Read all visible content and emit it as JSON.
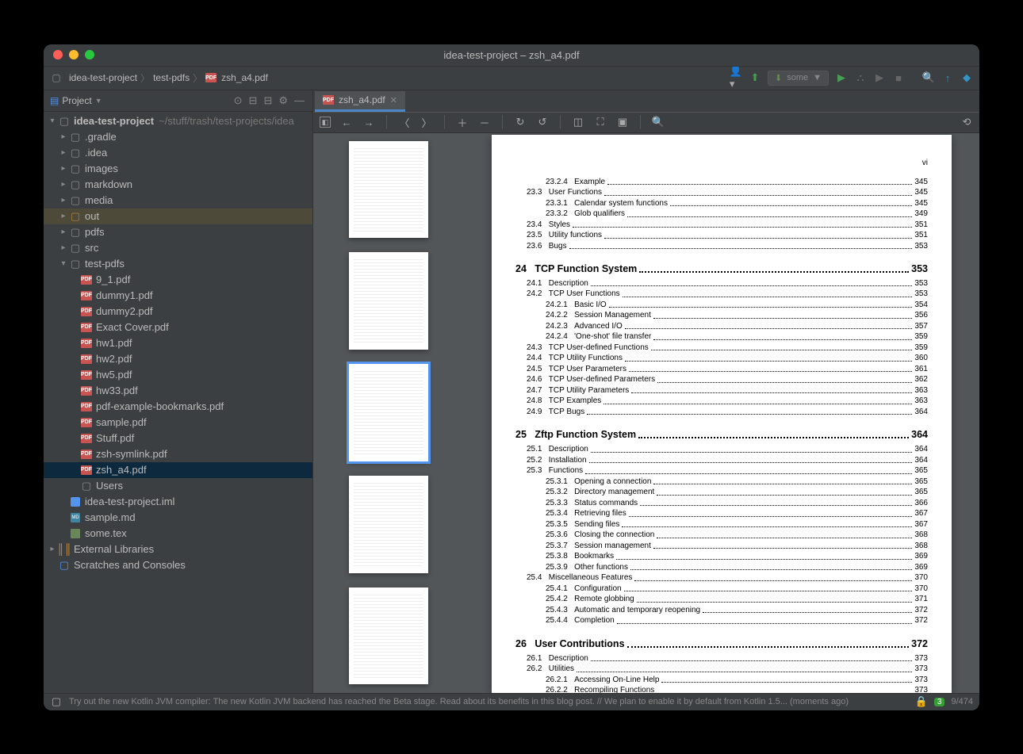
{
  "window_title": "idea-test-project – zsh_a4.pdf",
  "breadcrumbs": [
    "idea-test-project",
    "test-pdfs",
    "zsh_a4.pdf"
  ],
  "run_config": "some",
  "sidebar": {
    "title": "Project",
    "project_name": "idea-test-project",
    "project_path": "~/stuff/trash/test-projects/idea",
    "folders": [
      ".gradle",
      ".idea",
      "images",
      "markdown",
      "media",
      "out",
      "pdfs",
      "src"
    ],
    "testpdfs_label": "test-pdfs",
    "pdfs": [
      "9_1.pdf",
      "dummy1.pdf",
      "dummy2.pdf",
      "Exact Cover.pdf",
      "hw1.pdf",
      "hw2.pdf",
      "hw5.pdf",
      "hw33.pdf",
      "pdf-example-bookmarks.pdf",
      "sample.pdf",
      "Stuff.pdf",
      "zsh-symlink.pdf",
      "zsh_a4.pdf"
    ],
    "users": "Users",
    "iml": "idea-test-project.iml",
    "samplemd": "sample.md",
    "sometex": "some.tex",
    "ext": "External Libraries",
    "scratch": "Scratches and Consoles"
  },
  "tab_label": "zsh_a4.pdf",
  "page_num_corner": "vi",
  "toc_pre": [
    {
      "n": "23.2.4",
      "t": "Example",
      "p": "345",
      "i": 2
    },
    {
      "n": "23.3",
      "t": "User Functions",
      "p": "345",
      "i": 1
    },
    {
      "n": "23.3.1",
      "t": "Calendar system functions",
      "p": "345",
      "i": 2
    },
    {
      "n": "23.3.2",
      "t": "Glob qualifiers",
      "p": "349",
      "i": 2
    },
    {
      "n": "23.4",
      "t": "Styles",
      "p": "351",
      "i": 1
    },
    {
      "n": "23.5",
      "t": "Utility functions",
      "p": "351",
      "i": 1
    },
    {
      "n": "23.6",
      "t": "Bugs",
      "p": "353",
      "i": 1
    }
  ],
  "toc_24_h": {
    "n": "24",
    "t": "TCP Function System",
    "p": "353"
  },
  "toc_24": [
    {
      "n": "24.1",
      "t": "Description",
      "p": "353",
      "i": 1
    },
    {
      "n": "24.2",
      "t": "TCP User Functions",
      "p": "353",
      "i": 1
    },
    {
      "n": "24.2.1",
      "t": "Basic I/O",
      "p": "354",
      "i": 2
    },
    {
      "n": "24.2.2",
      "t": "Session Management",
      "p": "356",
      "i": 2
    },
    {
      "n": "24.2.3",
      "t": "Advanced I/O",
      "p": "357",
      "i": 2
    },
    {
      "n": "24.2.4",
      "t": "'One-shot' file transfer",
      "p": "359",
      "i": 2
    },
    {
      "n": "24.3",
      "t": "TCP User-defined Functions",
      "p": "359",
      "i": 1
    },
    {
      "n": "24.4",
      "t": "TCP Utility Functions",
      "p": "360",
      "i": 1
    },
    {
      "n": "24.5",
      "t": "TCP User Parameters",
      "p": "361",
      "i": 1
    },
    {
      "n": "24.6",
      "t": "TCP User-defined Parameters",
      "p": "362",
      "i": 1
    },
    {
      "n": "24.7",
      "t": "TCP Utility Parameters",
      "p": "363",
      "i": 1
    },
    {
      "n": "24.8",
      "t": "TCP Examples",
      "p": "363",
      "i": 1
    },
    {
      "n": "24.9",
      "t": "TCP Bugs",
      "p": "364",
      "i": 1
    }
  ],
  "toc_25_h": {
    "n": "25",
    "t": "Zftp Function System",
    "p": "364"
  },
  "toc_25": [
    {
      "n": "25.1",
      "t": "Description",
      "p": "364",
      "i": 1
    },
    {
      "n": "25.2",
      "t": "Installation",
      "p": "364",
      "i": 1
    },
    {
      "n": "25.3",
      "t": "Functions",
      "p": "365",
      "i": 1
    },
    {
      "n": "25.3.1",
      "t": "Opening a connection",
      "p": "365",
      "i": 2
    },
    {
      "n": "25.3.2",
      "t": "Directory management",
      "p": "365",
      "i": 2
    },
    {
      "n": "25.3.3",
      "t": "Status commands",
      "p": "366",
      "i": 2
    },
    {
      "n": "25.3.4",
      "t": "Retrieving files",
      "p": "367",
      "i": 2
    },
    {
      "n": "25.3.5",
      "t": "Sending files",
      "p": "367",
      "i": 2
    },
    {
      "n": "25.3.6",
      "t": "Closing the connection",
      "p": "368",
      "i": 2
    },
    {
      "n": "25.3.7",
      "t": "Session management",
      "p": "368",
      "i": 2
    },
    {
      "n": "25.3.8",
      "t": "Bookmarks",
      "p": "369",
      "i": 2
    },
    {
      "n": "25.3.9",
      "t": "Other functions",
      "p": "369",
      "i": 2
    },
    {
      "n": "25.4",
      "t": "Miscellaneous Features",
      "p": "370",
      "i": 1
    },
    {
      "n": "25.4.1",
      "t": "Configuration",
      "p": "370",
      "i": 2
    },
    {
      "n": "25.4.2",
      "t": "Remote globbing",
      "p": "371",
      "i": 2
    },
    {
      "n": "25.4.3",
      "t": "Automatic and temporary reopening",
      "p": "372",
      "i": 2
    },
    {
      "n": "25.4.4",
      "t": "Completion",
      "p": "372",
      "i": 2
    }
  ],
  "toc_26_h": {
    "n": "26",
    "t": "User Contributions",
    "p": "372"
  },
  "toc_26": [
    {
      "n": "26.1",
      "t": "Description",
      "p": "373",
      "i": 1
    },
    {
      "n": "26.2",
      "t": "Utilities",
      "p": "373",
      "i": 1
    },
    {
      "n": "26.2.1",
      "t": "Accessing On-Line Help",
      "p": "373",
      "i": 2
    },
    {
      "n": "26.2.2",
      "t": "Recompiling Functions",
      "p": "373",
      "i": 2
    }
  ],
  "status_tip": "Try out the new Kotlin JVM compiler: The new Kotlin JVM backend has reached the Beta stage. Read about its benefits in this blog post. // We plan to enable it by default from Kotlin 1.5... (moments ago)",
  "status_badge": "3",
  "status_page": "9/474"
}
